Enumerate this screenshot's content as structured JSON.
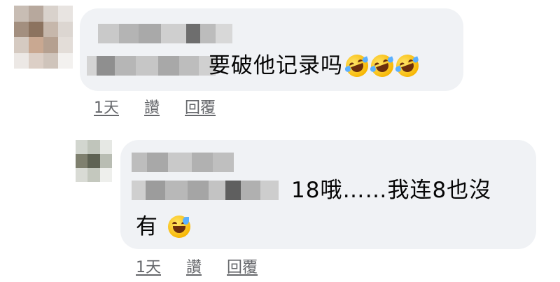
{
  "comments": [
    {
      "text": "要破他记录吗",
      "emojis": [
        "rolling-on-floor-laughing",
        "rolling-on-floor-laughing",
        "rolling-on-floor-laughing"
      ],
      "actions": {
        "time": "1天",
        "like": "讚",
        "reply": "回覆"
      }
    },
    {
      "text_line1": "18哦……我连8也沒",
      "text_line2": "有",
      "emojis": [
        "grinning-face-with-sweat"
      ],
      "actions": {
        "time": "1天",
        "like": "讚",
        "reply": "回覆"
      }
    }
  ],
  "colors": {
    "bubble": "#f0f2f5",
    "action_text": "#65676b",
    "text": "#050505"
  }
}
